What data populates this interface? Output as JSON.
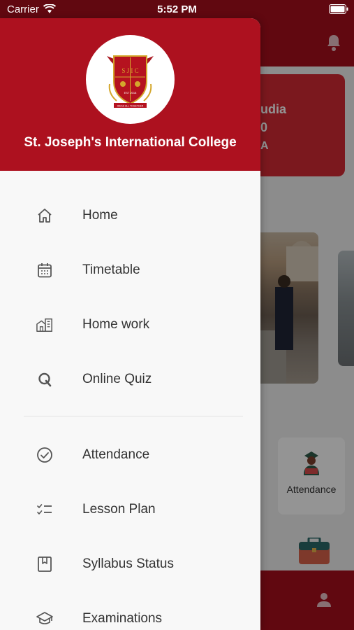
{
  "status_bar": {
    "carrier": "Carrier",
    "time": "5:52 PM"
  },
  "background": {
    "card_line1": "udia",
    "card_line2": "0",
    "card_line3": "A",
    "tile_label": "Attendance"
  },
  "drawer": {
    "college_name": "St. Joseph's International College",
    "logo_text": {
      "letters": "S J I C",
      "est": "EST 2018",
      "motto": "IDEAS ALL TOGETHER"
    },
    "items": [
      {
        "label": "Home",
        "icon": "home-icon"
      },
      {
        "label": "Timetable",
        "icon": "calendar-icon"
      },
      {
        "label": "Home work",
        "icon": "homework-icon"
      },
      {
        "label": "Online Quiz",
        "icon": "quiz-icon"
      },
      {
        "label": "Attendance",
        "icon": "check-circle-icon"
      },
      {
        "label": "Lesson Plan",
        "icon": "checklist-icon"
      },
      {
        "label": "Syllabus Status",
        "icon": "bookmark-icon"
      },
      {
        "label": "Examinations",
        "icon": "graduation-cap-icon"
      }
    ]
  },
  "colors": {
    "brand_red": "#ad111f",
    "card_red": "#d42a35",
    "icon_gray": "#555555"
  }
}
